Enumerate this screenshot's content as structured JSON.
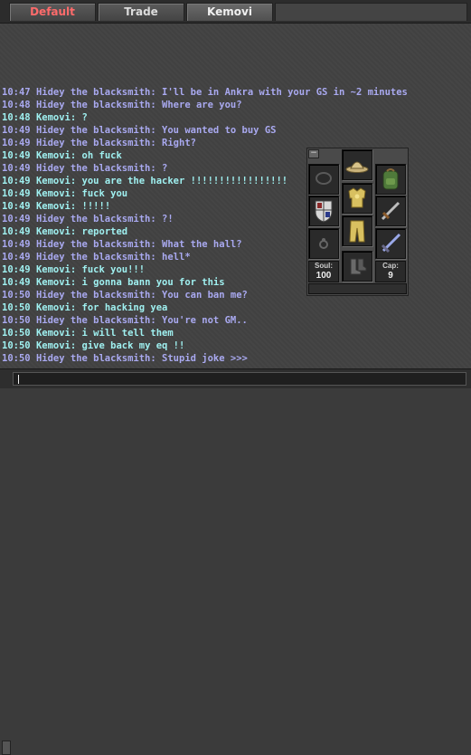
{
  "tabs": [
    {
      "label": "Default"
    },
    {
      "label": "Trade"
    },
    {
      "label": "Kemovi"
    }
  ],
  "messages": [
    {
      "time": "10:47",
      "speaker": "Hidey the blacksmith",
      "text": "I'll be in Ankra with your GS in ~2 minutes"
    },
    {
      "time": "10:48",
      "speaker": "Hidey the blacksmith",
      "text": "Where are you?"
    },
    {
      "time": "10:48",
      "speaker": "Kemovi",
      "text": "?"
    },
    {
      "time": "10:49",
      "speaker": "Hidey the blacksmith",
      "text": "You wanted to buy GS"
    },
    {
      "time": "10:49",
      "speaker": "Hidey the blacksmith",
      "text": "Right?"
    },
    {
      "time": "10:49",
      "speaker": "Kemovi",
      "text": "oh fuck"
    },
    {
      "time": "10:49",
      "speaker": "Hidey the blacksmith",
      "text": "?"
    },
    {
      "time": "10:49",
      "speaker": "Kemovi",
      "text": "you are the hacker !!!!!!!!!!!!!!!!!"
    },
    {
      "time": "10:49",
      "speaker": "Kemovi",
      "text": "fuck you"
    },
    {
      "time": "10:49",
      "speaker": "Kemovi",
      "text": "!!!!!"
    },
    {
      "time": "10:49",
      "speaker": "Hidey the blacksmith",
      "text": "?!"
    },
    {
      "time": "10:49",
      "speaker": "Kemovi",
      "text": "reported"
    },
    {
      "time": "10:49",
      "speaker": "Hidey the blacksmith",
      "text": "What the hall?"
    },
    {
      "time": "10:49",
      "speaker": "Hidey the blacksmith",
      "text": "hell*"
    },
    {
      "time": "10:49",
      "speaker": "Kemovi",
      "text": "fuck you!!!"
    },
    {
      "time": "10:49",
      "speaker": "Kemovi",
      "text": "i gonna bann you for this"
    },
    {
      "time": "10:50",
      "speaker": "Hidey the blacksmith",
      "text": "You can ban me?"
    },
    {
      "time": "10:50",
      "speaker": "Kemovi",
      "text": "for hacking yea"
    },
    {
      "time": "10:50",
      "speaker": "Hidey the blacksmith",
      "text": "You're not GM.."
    },
    {
      "time": "10:50",
      "speaker": "Kemovi",
      "text": "i will tell them"
    },
    {
      "time": "10:50",
      "speaker": "Kemovi",
      "text": "give back my eq !!"
    },
    {
      "time": "10:50",
      "speaker": "Hidey the blacksmith",
      "text": "Stupid joke >>>"
    }
  ],
  "inventory": {
    "minimize_label": "−",
    "soul_label": "Soul:",
    "soul_value": "100",
    "cap_label": "Cap:",
    "cap_value": "9"
  },
  "colors": {
    "hidey": "#a9a9f0",
    "kemovi": "#9ff0f0",
    "active_tab_default": "#ff6b6b"
  }
}
